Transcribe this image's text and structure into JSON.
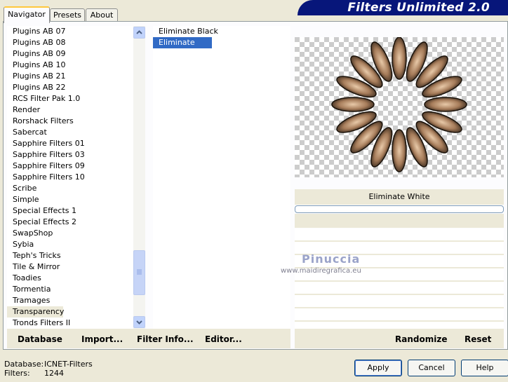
{
  "tabs": [
    "Navigator",
    "Presets",
    "About"
  ],
  "app_title": "Filters Unlimited 2.0",
  "categories": [
    "Plugins AB 07",
    "Plugins AB 08",
    "Plugins AB 09",
    "Plugins AB 10",
    "Plugins AB 21",
    "Plugins AB 22",
    "RCS Filter Pak 1.0",
    "Render",
    "Rorshack Filters",
    "Sabercat",
    "Sapphire Filters 01",
    "Sapphire Filters 03",
    "Sapphire Filters 09",
    "Sapphire Filters 10",
    "Scribe",
    "Simple",
    "Special Effects 1",
    "Special Effects 2",
    "SwapShop",
    "Sybia",
    "Teph's Tricks",
    "Tile & Mirror",
    "Toadies",
    "Tormentia",
    "Tramages",
    "Transparency",
    "Tronds Filters II"
  ],
  "selected_category": "Transparency",
  "filters": [
    "Eliminate Black",
    "Eliminate White"
  ],
  "selected_filter": "Eliminate White",
  "preview_filter_name": "Eliminate White",
  "progress": 0,
  "watermark": {
    "name": "Pinuccia",
    "url": "www.maidiregrafica.eu"
  },
  "left_buttons": {
    "database": "Database",
    "import": "Import...",
    "filter_info": "Filter Info...",
    "editor": "Editor..."
  },
  "right_buttons": {
    "randomize": "Randomize",
    "reset": "Reset"
  },
  "status": {
    "database_label": "Database:",
    "database_value": "ICNET-Filters",
    "filters_label": "Filters:",
    "filters_value": "1244"
  },
  "dialog_buttons": {
    "apply": "Apply",
    "cancel": "Cancel",
    "help": "Help"
  },
  "colors": {
    "accent": "#316ac5",
    "banner": "#07167a",
    "face": "#ece9d8"
  }
}
